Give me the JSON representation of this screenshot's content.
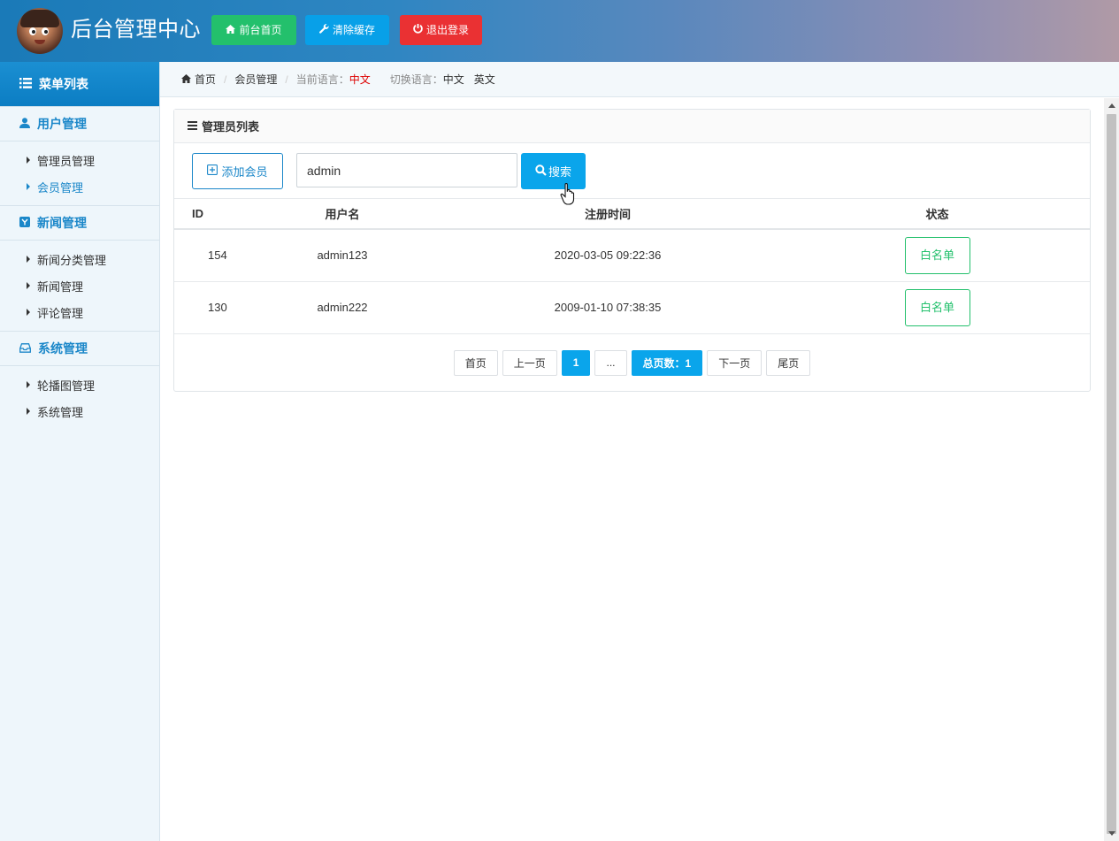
{
  "header": {
    "title": "后台管理中心",
    "buttons": [
      {
        "label": "前台首页",
        "icon": "home-icon",
        "color": "#23c06c"
      },
      {
        "label": "清除缓存",
        "icon": "wrench-icon",
        "color": "#08a0e8"
      },
      {
        "label": "退出登录",
        "icon": "power-icon",
        "color": "#ea3133"
      }
    ]
  },
  "sidebar": {
    "title": "菜单列表",
    "groups": [
      {
        "label": "用户管理",
        "icon": "user-icon",
        "items": [
          {
            "label": "管理员管理",
            "active": false
          },
          {
            "label": "会员管理",
            "active": true
          }
        ]
      },
      {
        "label": "新闻管理",
        "icon": "news-icon",
        "items": [
          {
            "label": "新闻分类管理",
            "active": false
          },
          {
            "label": "新闻管理",
            "active": false
          },
          {
            "label": "评论管理",
            "active": false
          }
        ]
      },
      {
        "label": "系统管理",
        "icon": "inbox-icon",
        "items": [
          {
            "label": "轮播图管理",
            "active": false
          },
          {
            "label": "系统管理",
            "active": false
          }
        ]
      }
    ]
  },
  "breadcrumb": {
    "home": "首页",
    "current": "会员管理",
    "lang_label": "当前语言：",
    "lang_value": "中文",
    "switch_label": "切换语言：",
    "switch_options": [
      "中文",
      "英文"
    ]
  },
  "panel": {
    "title": "管理员列表",
    "add_label": "添加会员",
    "search_value": "admin",
    "search_label": "搜索",
    "columns": [
      "ID",
      "用户名",
      "注册时间",
      "状态"
    ],
    "rows": [
      {
        "id": "154",
        "username": "admin123",
        "time": "2020-03-05 09:22:36",
        "status": "白名单"
      },
      {
        "id": "130",
        "username": "admin222",
        "time": "2009-01-10 07:38:35",
        "status": "白名单"
      }
    ],
    "pager": {
      "first": "首页",
      "prev": "上一页",
      "current": "1",
      "ellipsis": "...",
      "total": "总页数：1",
      "next": "下一页",
      "last": "尾页"
    }
  }
}
